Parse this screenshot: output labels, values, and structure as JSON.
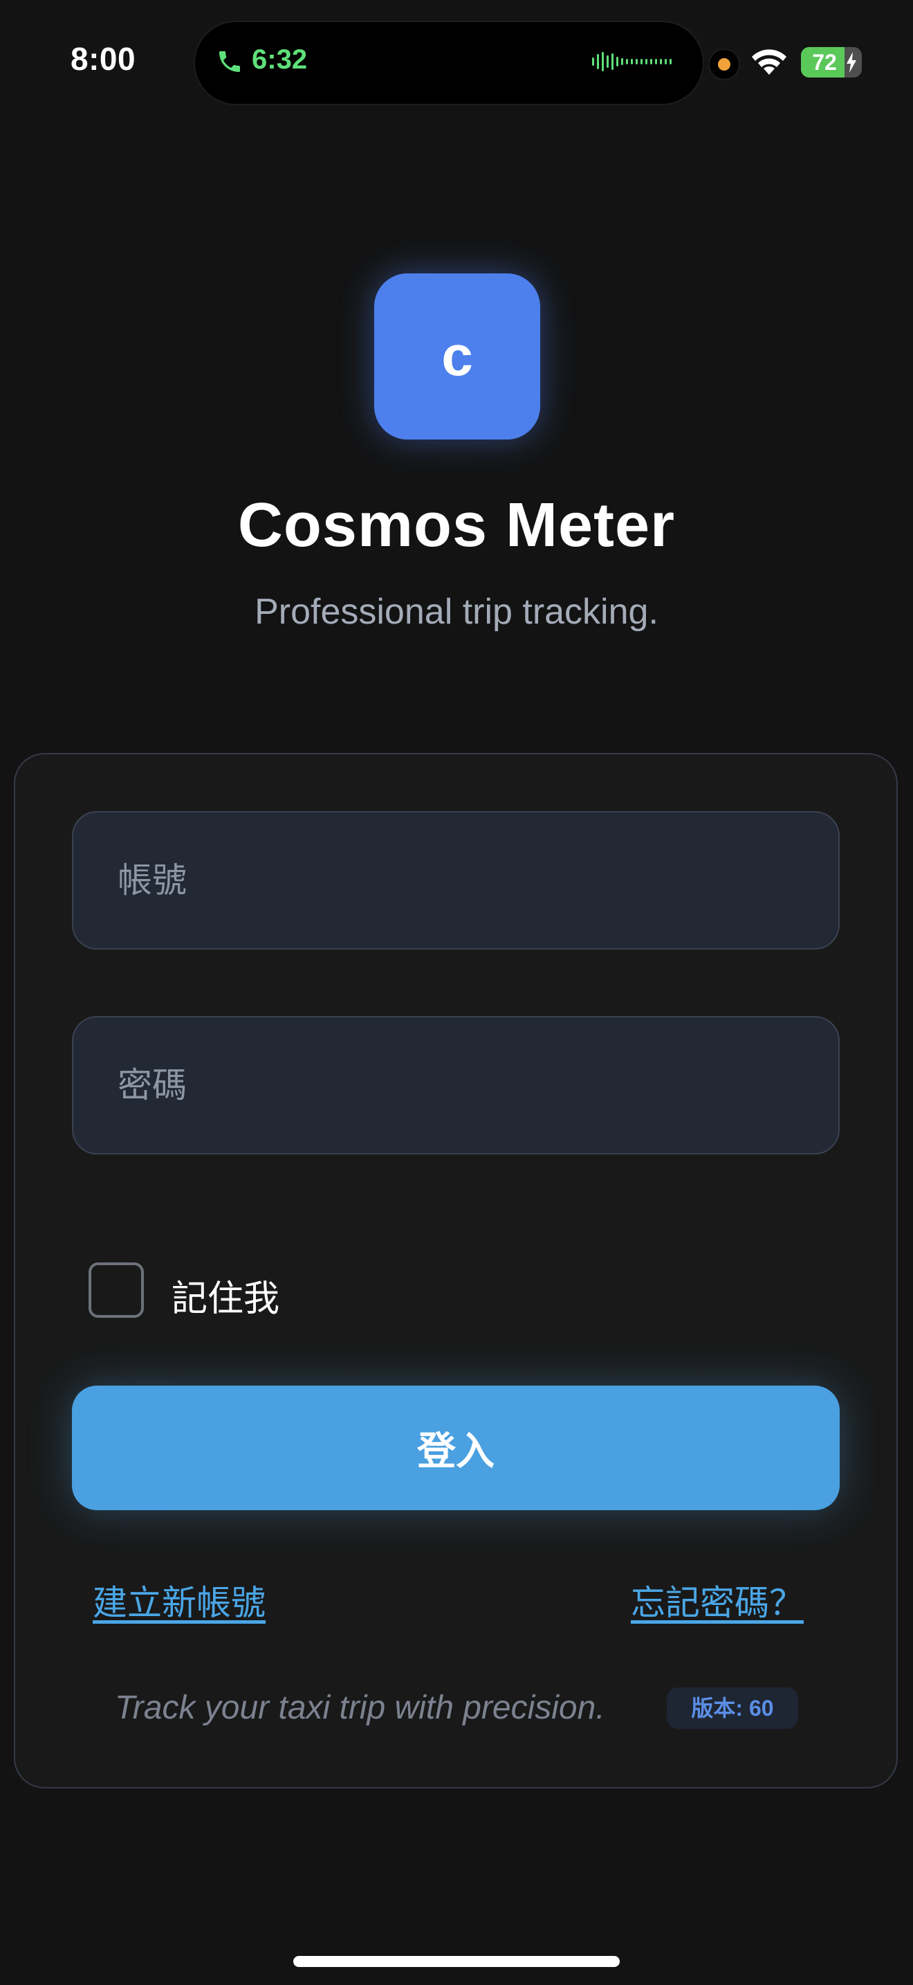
{
  "status_bar": {
    "time": "8:00",
    "call_time": "6:32",
    "battery_percent": 72,
    "battery_label": "72",
    "call_color": "#5fe07a",
    "privacy_dot_color": "#f2a23a",
    "icons": [
      "phone-icon",
      "audio-waveform-icon",
      "microphone-indicator-icon",
      "wifi-icon",
      "battery-icon",
      "charging-bolt-icon"
    ]
  },
  "header": {
    "logo_letter": "c",
    "title": "Cosmos Meter",
    "subtitle": "Professional trip tracking."
  },
  "login_form": {
    "username_placeholder": "帳號",
    "username_value": "",
    "password_placeholder": "密碼",
    "password_value": "",
    "remember_me_label": "記住我",
    "remember_me_checked": false,
    "login_button_label": "登入",
    "create_account_link": "建立新帳號",
    "forgot_password_link": "忘記密碼？",
    "tagline": "Track your taxi trip with precision.",
    "version_label": "版本: 60"
  },
  "colors": {
    "background": "#131313",
    "card_background": "#191919",
    "accent_logo": "#4d80ed",
    "accent_button": "#4aa0e0",
    "link": "#4aa6e6"
  }
}
